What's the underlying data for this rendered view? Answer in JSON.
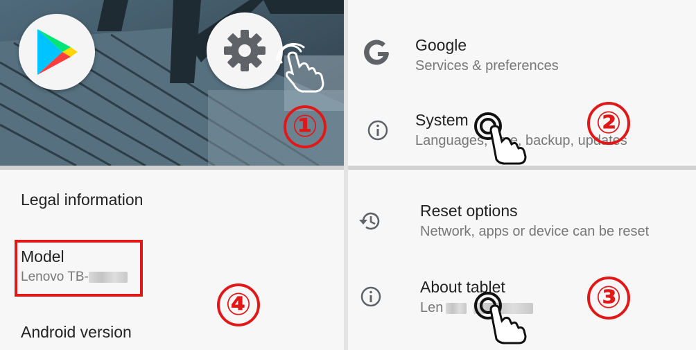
{
  "step_badges": {
    "step1": "①",
    "step2": "②",
    "step3": "③",
    "step4": "④"
  },
  "google": {
    "title": "Google",
    "subtitle": "Services & preferences",
    "icon": "google-g-icon"
  },
  "system": {
    "title": "System",
    "subtitle": "Languages, time, backup, updates",
    "icon": "info-icon"
  },
  "reset": {
    "title": "Reset options",
    "subtitle": "Network, apps or device can be reset",
    "icon": "history-icon"
  },
  "about": {
    "title": "About tablet",
    "subtitle": "Len",
    "icon": "info-icon"
  },
  "legal": {
    "title": "Legal information"
  },
  "model": {
    "title": "Model",
    "value": "Lenovo TB-"
  },
  "android": {
    "title": "Android version"
  },
  "apps": {
    "play_store": "play-store-icon",
    "settings": "settings-gear-icon"
  },
  "colors": {
    "highlight": "#e01818",
    "background": "#f7f7f7"
  }
}
